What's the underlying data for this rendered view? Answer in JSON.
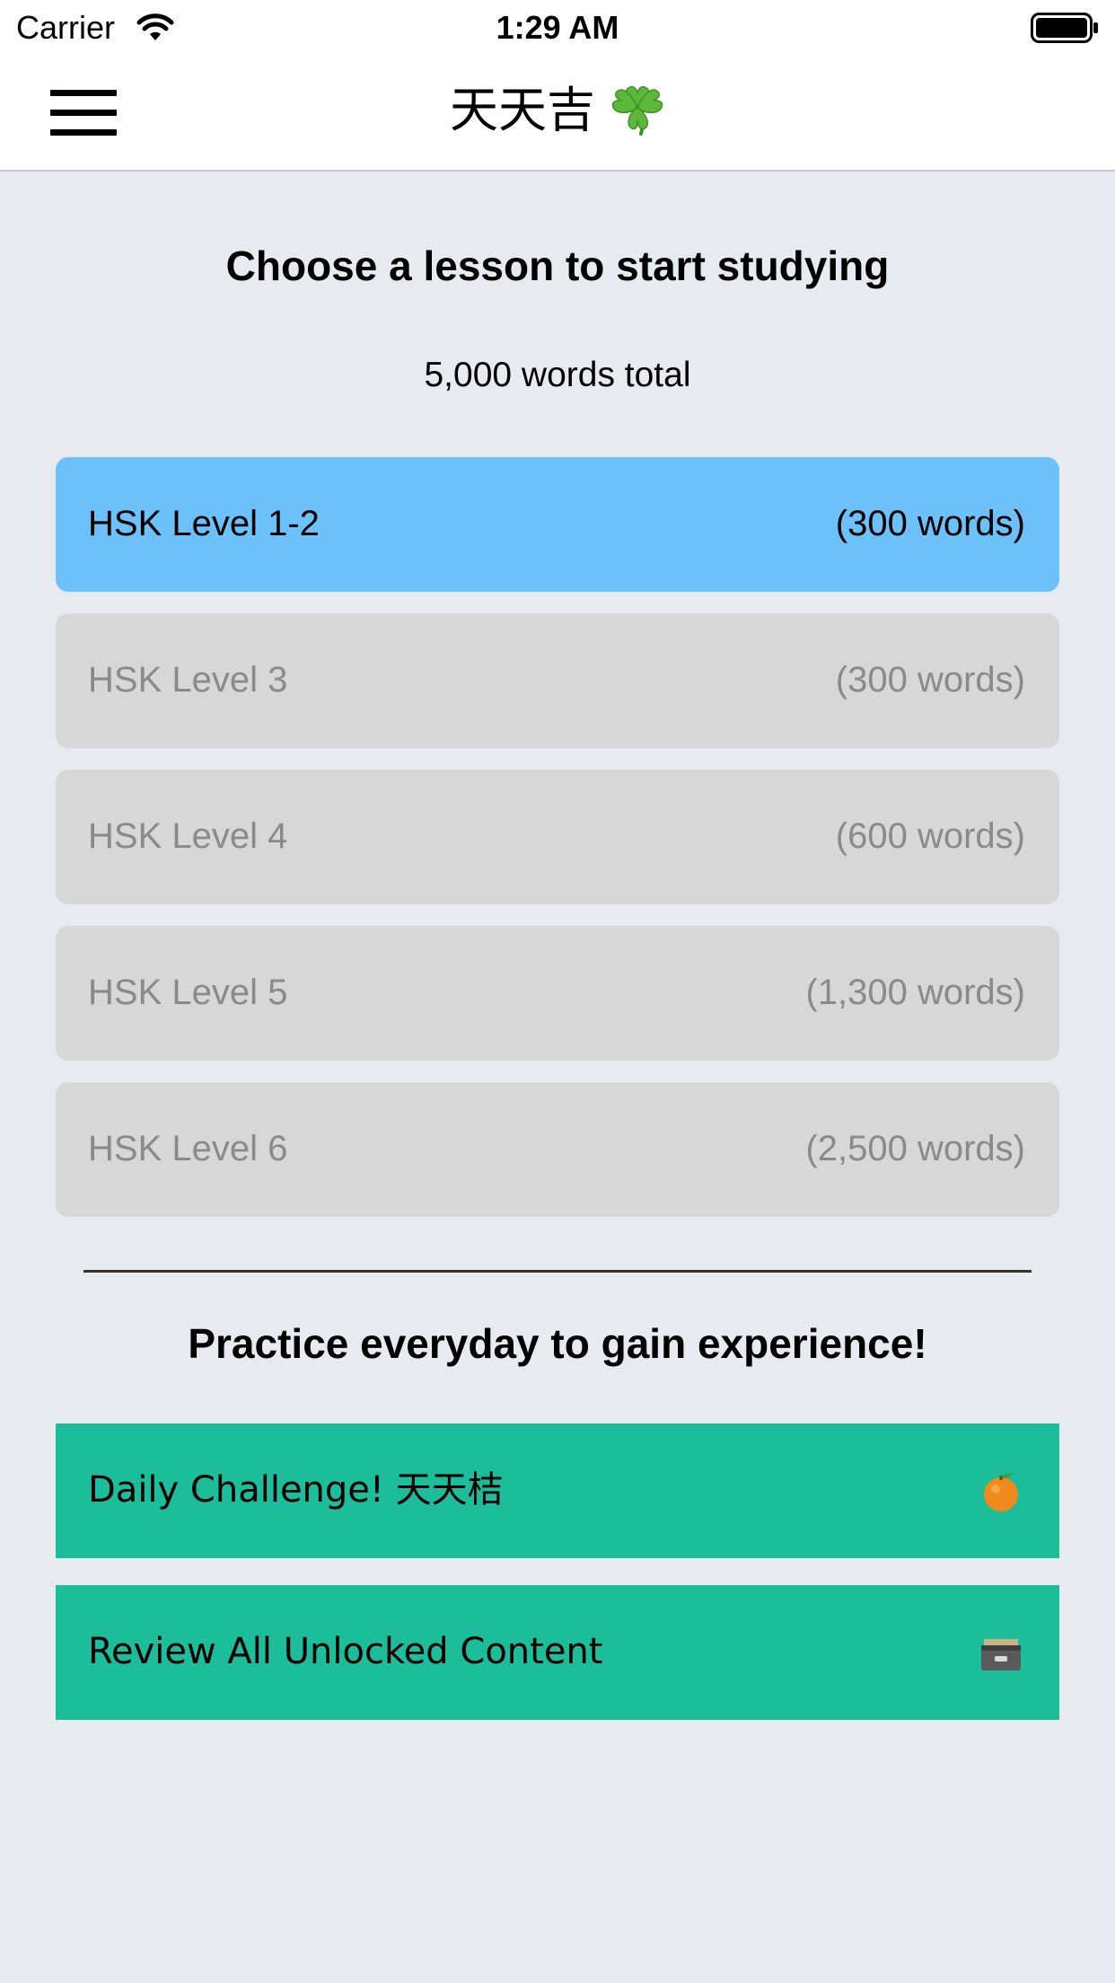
{
  "status_bar": {
    "carrier": "Carrier",
    "time": "1:29 AM"
  },
  "nav": {
    "title": "天天吉",
    "title_icon": "four-leaf-clover-icon",
    "menu_icon": "hamburger-menu-icon"
  },
  "main": {
    "heading": "Choose a lesson to start studying",
    "total": "5,000 words total",
    "lessons": [
      {
        "label": "HSK Level 1-2",
        "count": "(300 words)",
        "unlocked": true
      },
      {
        "label": "HSK Level 3",
        "count": "(300 words)",
        "unlocked": false
      },
      {
        "label": "HSK Level 4",
        "count": "(600 words)",
        "unlocked": false
      },
      {
        "label": "HSK Level 5",
        "count": "(1,300 words)",
        "unlocked": false
      },
      {
        "label": "HSK Level 6",
        "count": "(2,500 words)",
        "unlocked": false
      }
    ],
    "practice_heading": "Practice everyday to gain experience!",
    "actions": [
      {
        "label": "Daily Challenge! 天天桔",
        "icon": "tangerine-icon"
      },
      {
        "label": "Review All Unlocked Content",
        "icon": "card-file-box-icon"
      }
    ]
  },
  "colors": {
    "background": "#e7ebef",
    "active_lesson": "#6cc1fb",
    "locked_lesson": "#d7d7d7",
    "action": "#1cbd9a"
  }
}
